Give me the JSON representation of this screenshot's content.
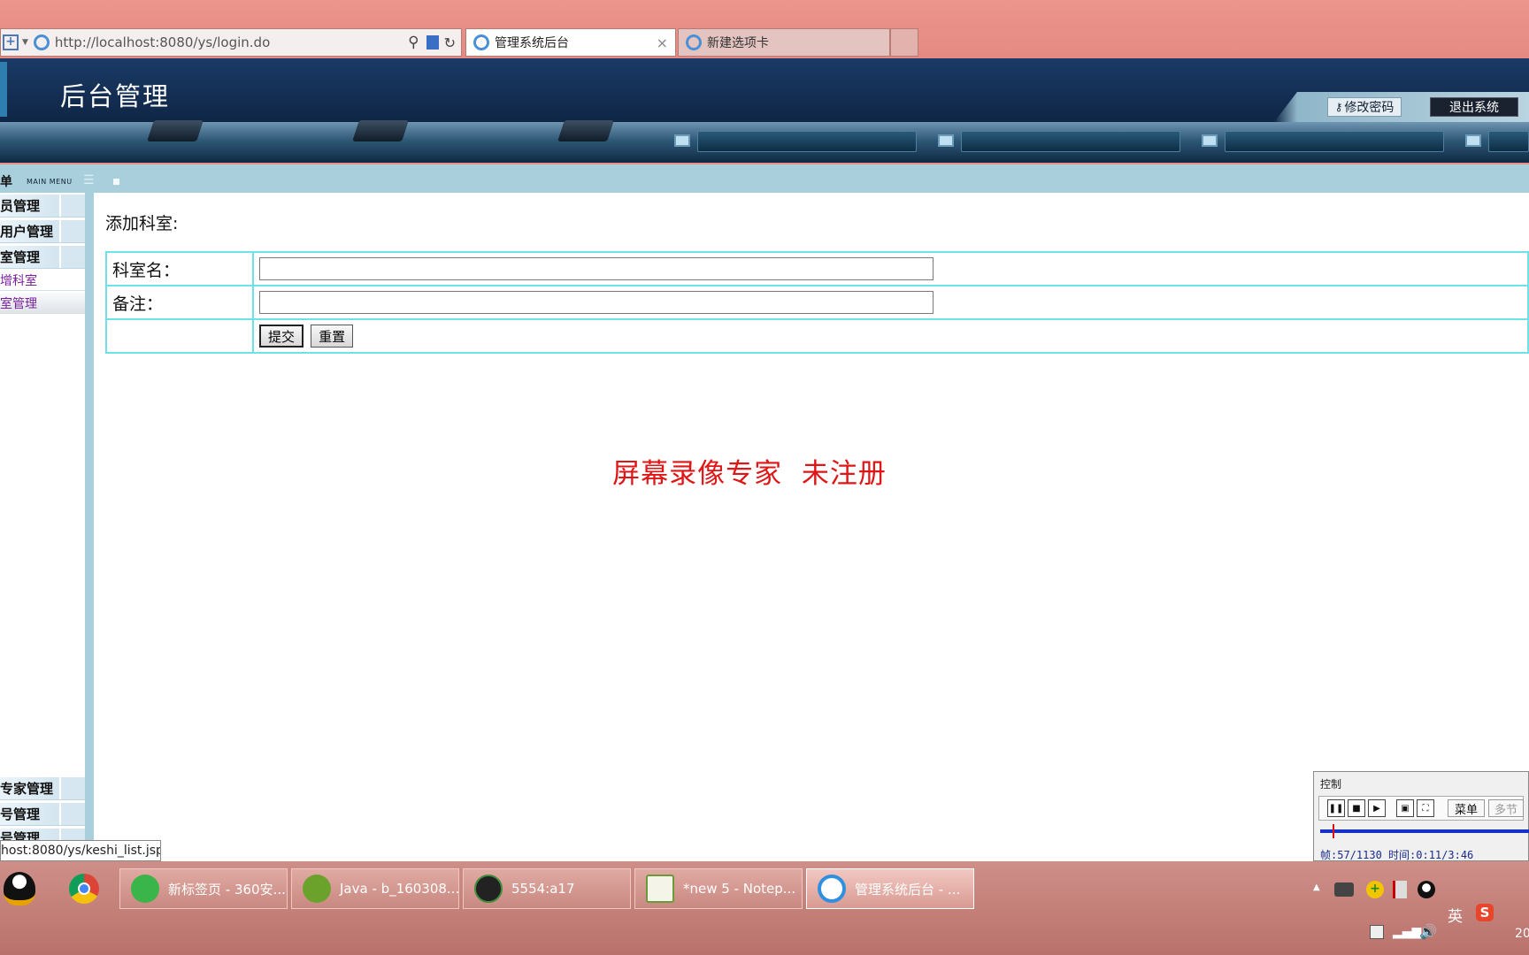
{
  "browser": {
    "address": "http://localhost:8080/ys/login.do",
    "tabs": [
      {
        "title": "管理系统后台",
        "close": "×"
      },
      {
        "title": "新建选项卡"
      }
    ]
  },
  "header": {
    "title": "后台管理",
    "change_password": "修改密码",
    "logout": "退出系统"
  },
  "menu": {
    "title": "菜单",
    "subtitle": "MAIN MENU"
  },
  "sidebar": {
    "items": [
      "员管理",
      "用户管理",
      "室管理"
    ],
    "subitems": [
      "增科室",
      "室管理"
    ],
    "bottom_items": [
      "专家管理",
      "号管理",
      "号管理"
    ]
  },
  "form": {
    "title": "添加科室:",
    "fields": [
      {
        "label": "科室名：",
        "value": ""
      },
      {
        "label": "备注：",
        "value": ""
      }
    ],
    "submit": "提交",
    "reset": "重置"
  },
  "watermark": "屏幕录像专家  未注册",
  "status_url": "host:8080/ys/keshi_list.jsp",
  "recorder": {
    "title": "控制",
    "menu_button": "菜单",
    "step_button": "多节",
    "info": "帧:57/1130 时间:0:11/3:46"
  },
  "taskbar": {
    "items": [
      "新标签页 - 360安...",
      "Java - b_160308...",
      "5554:a17",
      "*new 5 - Notep...",
      "管理系统后台 - ..."
    ],
    "tray_lang": "英",
    "clock_fragment": "20"
  },
  "colors": {
    "header_bg": "#0f2645",
    "menu_bar": "#a9cfdd",
    "form_border": "#6de2e8",
    "watermark": "#e01515",
    "taskbar": "#c88880"
  }
}
